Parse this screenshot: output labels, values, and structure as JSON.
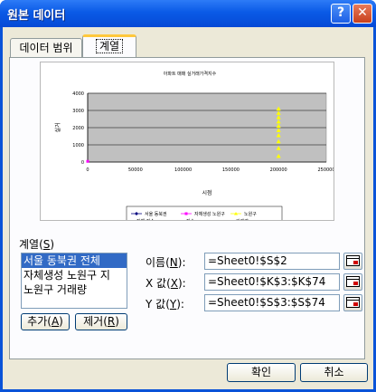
{
  "window": {
    "title": "원본 데이터",
    "help_symbol": "?",
    "close_symbol": "✕"
  },
  "tabs": [
    {
      "label": "데이터 범위",
      "selected": false
    },
    {
      "label": "계열",
      "selected": true
    }
  ],
  "chart_data": {
    "type": "scatter",
    "title": "아파트 매매 실거래가격지수",
    "xlabel": "시점",
    "ylabel": "실거",
    "xlim": [
      0,
      250000
    ],
    "ylim": [
      0,
      4000
    ],
    "x_ticks": [
      "0",
      "50000",
      "100000",
      "150000",
      "200000",
      "250000"
    ],
    "y_ticks": [
      "0",
      "500",
      "1000",
      "1500",
      "2000",
      "2500",
      "3000",
      "3500",
      "4000"
    ],
    "series": [
      {
        "name": "서울 동북권 전체 지수",
        "color": "#000080",
        "marker": "diamond",
        "x": [],
        "y": []
      },
      {
        "name": "자체생성 노원구 지수",
        "color": "#ff00ff",
        "marker": "square",
        "x": [
          0
        ],
        "y": [
          40
        ]
      },
      {
        "name": "노원구 거래량",
        "color": "#ffff00",
        "marker": "triangle",
        "x": [
          200000,
          200000,
          200000,
          200000,
          200000,
          200000,
          200000,
          200000,
          200000,
          200000
        ],
        "y": [
          3100,
          2850,
          2600,
          2350,
          2100,
          1850,
          1550,
          1200,
          800,
          350
        ]
      }
    ],
    "legend": "bottom",
    "plot_background": "#c0c0c0",
    "grid": true
  },
  "series_section": {
    "label": "계열",
    "shortcut": "S",
    "items": [
      {
        "label": "서울 동북권 전체",
        "selected": true
      },
      {
        "label": "자체생성 노원구 지",
        "selected": false
      },
      {
        "label": "노원구 거래량",
        "selected": false
      }
    ],
    "add_button": "추가",
    "add_shortcut": "A",
    "remove_button": "제거",
    "remove_shortcut": "R"
  },
  "fields": {
    "name_label": "이름",
    "name_shortcut": "N",
    "name_value": "=Sheet0!$S$2",
    "x_label": "X 값",
    "x_shortcut": "X",
    "x_value": "=Sheet0!$K$3:$K$74",
    "y_label": "Y 값",
    "y_shortcut": "Y",
    "y_value": "=Sheet0!$S$3:$S$74"
  },
  "footer": {
    "ok_button": "확인",
    "cancel_button": "취소"
  }
}
